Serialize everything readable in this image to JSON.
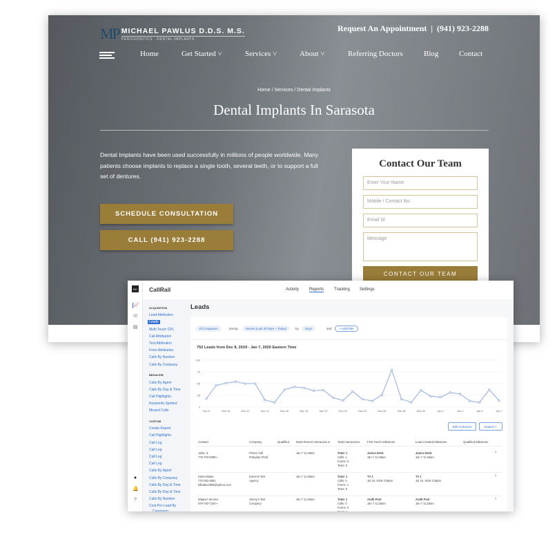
{
  "website": {
    "logo_mark": "MP",
    "logo_name": "Michael Pawlus D.D.S. M.S.",
    "logo_sub": "Periodontics · Dental Implants",
    "top_cta": "Request An Appointment  |  (941) 923-2288",
    "nav": [
      "Home",
      "Get Started ˅",
      "Services ˅",
      "About ˅",
      "Referring Doctors",
      "Blog",
      "Contact"
    ],
    "breadcrumb": "Home / Services / Dental Implants",
    "title": "Dental Implants In Sarasota",
    "intro": "Dental Implants have been used successfully in millions of people worldwide. Many patients choose implants to replace a single tooth, several teeth, or to support a full set of dentures.",
    "schedule_button": "SCHEDULE CONSULTATION",
    "call_button": "CALL (941) 923-2288",
    "form": {
      "title": "Contact Our Team",
      "name_placeholder": "Enter Your Name",
      "phone_placeholder": "Mobile / Contact No.",
      "email_placeholder": "Email Id",
      "message_placeholder": "Message",
      "submit": "CONTACT OUR TEAM"
    },
    "accent": "#9b7d3a"
  },
  "callrail": {
    "badge": "RC",
    "brand": "CallRail",
    "tabs": [
      "Activity",
      "Reports",
      "Tracking",
      "Settings"
    ],
    "active_tab": "Reports",
    "sidebar": [
      {
        "type": "h",
        "label": "ACQUISITION"
      },
      {
        "label": "Lead Attribution"
      },
      {
        "label": "Leads",
        "active": true
      },
      {
        "label": "Multi Touch CPL"
      },
      {
        "label": "Call Attribution"
      },
      {
        "label": "Text Attribution"
      },
      {
        "label": "Form Attribution"
      },
      {
        "label": "Calls By Number"
      },
      {
        "label": "Calls By Company"
      },
      {
        "type": "h",
        "label": "BEHAVIOR"
      },
      {
        "label": "Calls By Agent"
      },
      {
        "label": "Calls By Day & Time"
      },
      {
        "label": "Call Highlights"
      },
      {
        "label": "Keywords Spotted"
      },
      {
        "label": "Missed Calls"
      },
      {
        "type": "h",
        "label": "CUSTOM"
      },
      {
        "label": "Create Report"
      },
      {
        "label": "Call Highlights"
      },
      {
        "label": "Call Log"
      },
      {
        "label": "Call Log"
      },
      {
        "label": "Call Log"
      },
      {
        "label": "Call Log"
      },
      {
        "label": "Calls By Agent"
      },
      {
        "label": "Calls By Company"
      },
      {
        "label": "Calls By Day & Time"
      },
      {
        "label": "Calls By Day & Time"
      },
      {
        "label": "Calls By Number"
      },
      {
        "label": "Cost Per Lead By"
      },
      {
        "label": "  Campaign"
      }
    ],
    "page_title": "Leads",
    "filters": {
      "company": "All Companies",
      "during": "during",
      "range": "Recent (Last 30 Days + Today)",
      "by": "by",
      "interval": "Days",
      "and": "and",
      "add_filter": "+ Add Filter"
    },
    "edit_columns": "Edit Columns",
    "export": "Export",
    "columns": [
      "Contact",
      "Company",
      "Qualified",
      "Most Recent Interaction ▾",
      "Total Interactions",
      "First Touch Milestone",
      "Lead Created Milestone",
      "Qualified Milestone"
    ],
    "rows": [
      {
        "contact": [
          "Joliet, IL",
          "779-703-9285 ▪"
        ],
        "company": [
          "Phone Call",
          "Roleplay (Test)"
        ],
        "recent": "Jan 7 11:46am",
        "totals": [
          "Total: 1",
          "Calls: 1",
          "Forms: 0",
          "Texts: 0"
        ],
        "first": [
          "Janice Desk",
          "Jan 7 11:46am"
        ],
        "created": [
          "Janice Desk",
          "Jan 7 11:46am"
        ]
      },
      {
        "contact": [
          "Karen Baker",
          "770-362-3601",
          "kdbaker1908@yahoo.com"
        ],
        "company": [
          "Karen B Test",
          "Agency"
        ],
        "recent": "Jan 7 11:39am",
        "totals": [
          "Total: 1",
          "Calls: 0",
          "Forms: 1",
          "Texts: 0"
        ],
        "first": [
          "TV 1",
          "Jul 19, 2019 3:36pm"
        ],
        "created": [
          "TV 1",
          "Jul 19, 2019 3:36pm"
        ]
      },
      {
        "contact": [
          "Wagner Service",
          "678-782-7230 ▪"
        ],
        "company": [
          "Jimmy's Test",
          "Company"
        ],
        "recent": "Jan 7 11:25am",
        "totals": [
          "Total: 1",
          "Calls: 0",
          "Forms: 0",
          "Texts: 1"
        ],
        "first": [
          "Audit Pool",
          "Jan 7 11:25am"
        ],
        "created": [
          "Audit Pool",
          "Jan 7 11:25am"
        ]
      }
    ]
  },
  "chart_data": {
    "type": "line",
    "title": "752 Leads from Dec 8, 2019 - Jan 7, 2020 Eastern Time",
    "x": [
      "Dec 8",
      "Dec 9",
      "Dec 10",
      "Dec 11",
      "Dec 12",
      "Dec 13",
      "Dec 14",
      "Dec 15",
      "Dec 16",
      "Dec 17",
      "Dec 18",
      "Dec 19",
      "Dec 20",
      "Dec 21",
      "Dec 22",
      "Dec 23",
      "Dec 24",
      "Dec 25",
      "Dec 26",
      "Dec 27",
      "Dec 28",
      "Dec 29",
      "Dec 30",
      "Dec 31",
      "Jan 1",
      "Jan 2",
      "Jan 3",
      "Jan 4",
      "Jan 5",
      "Jan 6",
      "Jan 7"
    ],
    "values": [
      18,
      46,
      51,
      54,
      50,
      50,
      15,
      10,
      37,
      43,
      41,
      35,
      36,
      20,
      14,
      33,
      17,
      13,
      26,
      79,
      17,
      10,
      36,
      23,
      21,
      31,
      28,
      13,
      10,
      37,
      14
    ],
    "x_ticks": [
      "Dec 8",
      "Dec 10",
      "Dec 12",
      "Dec 14",
      "Dec 16",
      "Dec 18",
      "Dec 20",
      "Dec 22",
      "Dec 24",
      "Dec 26",
      "Dec 28",
      "Dec 30",
      "Jan 1",
      "Jan 3",
      "Jan 5",
      "Jan 7"
    ],
    "y_ticks": [
      0,
      25,
      50,
      75,
      100
    ],
    "ylim": [
      0,
      100
    ],
    "grid": true,
    "color": "#8eaadb"
  }
}
